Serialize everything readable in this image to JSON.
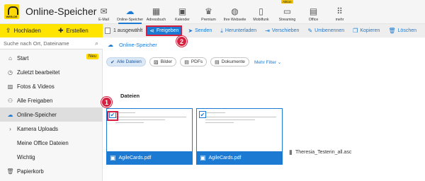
{
  "app": {
    "logo_text": "WEB.DE",
    "title": "Online-Speicher"
  },
  "nav": [
    {
      "label": "E-Mail",
      "icon": "mail-icon",
      "glyph": "✉"
    },
    {
      "label": "Online-Speicher",
      "icon": "cloud-icon",
      "glyph": "☁",
      "active": true
    },
    {
      "label": "Adressbuch",
      "icon": "address-book-icon",
      "glyph": "▦"
    },
    {
      "label": "Kalender",
      "icon": "calendar-icon",
      "glyph": "▣"
    },
    {
      "label": "Premium",
      "icon": "crown-icon",
      "glyph": "♛"
    },
    {
      "label": "Ihre Webseite",
      "icon": "website-icon",
      "glyph": "◍"
    },
    {
      "label": "Mobilfunk",
      "icon": "phone-icon",
      "glyph": "▯"
    },
    {
      "label": "Streaming",
      "icon": "tv-icon",
      "glyph": "▭",
      "badge": "Aktion"
    },
    {
      "label": "Office",
      "icon": "office-icon",
      "glyph": "▤"
    },
    {
      "label": "mehr",
      "icon": "grid-icon",
      "glyph": "⠿"
    }
  ],
  "toolbar": {
    "upload": "Hochladen",
    "create": "Erstellen",
    "selected_count": "1 ausgewählt",
    "share": "Freigeben",
    "send": "Senden",
    "download": "Herunterladen",
    "move": "Verschieben",
    "rename": "Umbenennen",
    "copy": "Kopieren",
    "delete": "Löschen"
  },
  "sidebar": {
    "search_placeholder": "Suche nach Ort, Dateiname",
    "items": [
      {
        "label": "Start",
        "badge": "Neu"
      },
      {
        "label": "Zuletzt bearbeitet"
      },
      {
        "label": "Fotos & Videos"
      },
      {
        "label": "Alle Freigaben"
      },
      {
        "label": "Online-Speicher",
        "active": true
      },
      {
        "label": "Kamera Uploads"
      },
      {
        "label": "Meine Office Dateien"
      },
      {
        "label": "Wichtig"
      },
      {
        "label": "Papierkorb"
      }
    ]
  },
  "main": {
    "breadcrumb": "Online-Speicher",
    "filters": [
      "Alle Dateien",
      "Bilder",
      "PDFs",
      "Dokumente"
    ],
    "more_filters": "Mehr Filter",
    "section_title": "Dateien",
    "files": [
      {
        "name": "AgileCards.pdf",
        "selected": true
      },
      {
        "name": "AgileCards.pdf",
        "selected": true
      },
      {
        "name": "Theresia_Testerin_all.asc",
        "selected": false
      }
    ]
  },
  "annotations": [
    "1",
    "2"
  ],
  "colors": {
    "accent": "#1c7ad2",
    "brand_yellow": "#ffe400",
    "marker_red": "#d5203f"
  }
}
